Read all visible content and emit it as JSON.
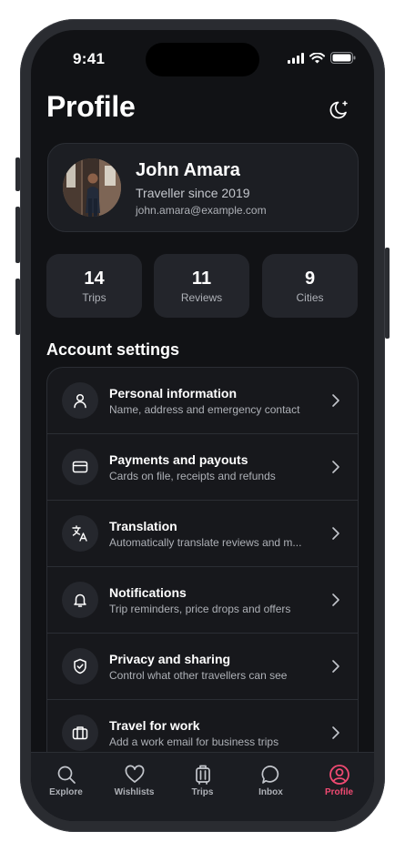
{
  "status_bar": {
    "time": "9:41"
  },
  "header": {
    "title": "Profile",
    "theme_icon": "moon-icon"
  },
  "profile": {
    "name": "John Amara",
    "subtitle": "Traveller since 2019",
    "email": "john.amara@example.com"
  },
  "stats": [
    {
      "value": "14",
      "label": "Trips"
    },
    {
      "value": "11",
      "label": "Reviews"
    },
    {
      "value": "9",
      "label": "Cities"
    }
  ],
  "section_title": "Account settings",
  "settings": [
    {
      "title": "Personal information",
      "subtitle": "Name, address and emergency contact",
      "icon": "person-icon"
    },
    {
      "title": "Payments and payouts",
      "subtitle": "Cards on file, receipts and refunds",
      "icon": "card-icon"
    },
    {
      "title": "Translation",
      "subtitle": "Automatically translate reviews and m...",
      "icon": "translate-icon"
    },
    {
      "title": "Notifications",
      "subtitle": "Trip reminders, price drops and offers",
      "icon": "bell-icon"
    },
    {
      "title": "Privacy and sharing",
      "subtitle": "Control what other travellers can see",
      "icon": "shield-icon"
    },
    {
      "title": "Travel for work",
      "subtitle": "Add a work email for business trips",
      "icon": "briefcase-icon"
    }
  ],
  "tabs": [
    {
      "label": "Explore",
      "icon": "search-icon"
    },
    {
      "label": "Wishlists",
      "icon": "heart-icon"
    },
    {
      "label": "Trips",
      "icon": "luggage-icon"
    },
    {
      "label": "Inbox",
      "icon": "chat-icon"
    },
    {
      "label": "Profile",
      "icon": "profile-icon",
      "active": true
    }
  ],
  "colors": {
    "accent": "#f04a72",
    "background": "#111215",
    "card": "#1c1e23"
  }
}
